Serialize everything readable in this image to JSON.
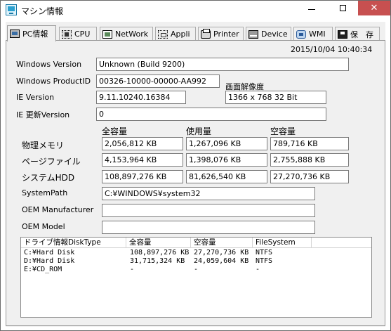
{
  "window": {
    "title": "マシン情報",
    "close_glyph": "✕"
  },
  "tabs": [
    {
      "label": "PC情報",
      "icon": "pc-icon"
    },
    {
      "label": "CPU",
      "icon": "cpu-icon"
    },
    {
      "label": "NetWork",
      "icon": "network-icon"
    },
    {
      "label": "Appli",
      "icon": "appli-icon"
    },
    {
      "label": "Printer",
      "icon": "printer-icon"
    },
    {
      "label": "Device",
      "icon": "device-icon"
    },
    {
      "label": "WMI",
      "icon": "wmi-icon"
    },
    {
      "label": "保　存",
      "icon": "save-icon"
    }
  ],
  "pc_info": {
    "timestamp": "2015/10/04 10:40:34",
    "windows_version_label": "Windows Version",
    "windows_version_value": "Unknown (Build 9200)",
    "product_id_label": "Windows ProductID",
    "product_id_value": "00326-10000-00000-AA992",
    "resolution_label": "画面解像度",
    "resolution_value": "1366 x 768 32 Bit",
    "ie_version_label": "IE Version",
    "ie_version_value": "9.11.10240.16384",
    "ie_update_label": "IE 更新Version",
    "ie_update_value": "0",
    "col_total": "全容量",
    "col_used": "使用量",
    "col_free": "空容量",
    "memory_label": "物理メモリ",
    "memory_total": "2,056,812 KB",
    "memory_used": "1,267,096 KB",
    "memory_free": "789,716 KB",
    "pagefile_label": "ページファイル",
    "pagefile_total": "4,153,964 KB",
    "pagefile_used": "1,398,076 KB",
    "pagefile_free": "2,755,888 KB",
    "hdd_label": "システムHDD",
    "hdd_total": "108,897,276 KB",
    "hdd_used": "81,626,540 KB",
    "hdd_free": "27,270,736 KB",
    "systempath_label": "SystemPath",
    "systempath_value": "C:¥WINDOWS¥system32",
    "oem_manufacturer_label": "OEM Manufacturer",
    "oem_manufacturer_value": "",
    "oem_model_label": "OEM Model",
    "oem_model_value": ""
  },
  "drives": {
    "columns": [
      "ドライブ情報DiskType",
      "全容量",
      "空容量",
      "FileSystem"
    ],
    "rows": [
      [
        "C:¥Hard Disk",
        "108,897,276 KB",
        "27,270,736 KB",
        "NTFS"
      ],
      [
        "D:¥Hard Disk",
        "31,715,324 KB",
        "24,059,604 KB",
        "NTFS"
      ],
      [
        "E:¥CD_ROM",
        "-",
        "-",
        "-"
      ]
    ]
  }
}
